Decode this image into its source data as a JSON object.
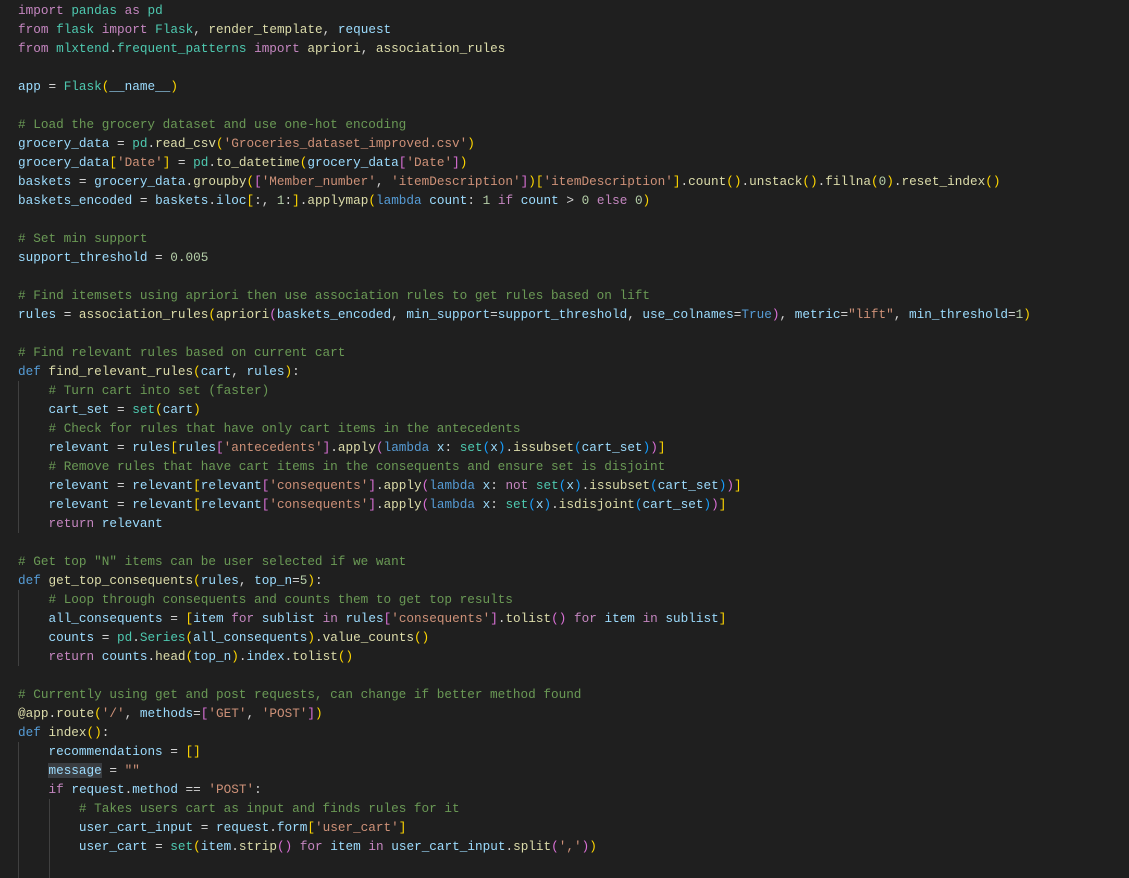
{
  "editor": {
    "language": "python",
    "theme_colors": {
      "background": "#1f1f1f",
      "keyword_control": "#c586c0",
      "keyword_storage": "#569cd6",
      "function": "#dcdcaa",
      "variable": "#9cdcfe",
      "type": "#4ec9b0",
      "string": "#ce9178",
      "number": "#b5cea8",
      "comment": "#6a9955",
      "bracket_level_1": "#ffd700",
      "bracket_level_2": "#da70d6",
      "bracket_level_3": "#179fff"
    },
    "highlighted_word": "message",
    "lines": [
      "import pandas as pd",
      "from flask import Flask, render_template, request",
      "from mlxtend.frequent_patterns import apriori, association_rules",
      "",
      "app = Flask(__name__)",
      "",
      "# Load the grocery dataset and use one-hot encoding",
      "grocery_data = pd.read_csv('Groceries_dataset_improved.csv')",
      "grocery_data['Date'] = pd.to_datetime(grocery_data['Date'])",
      "baskets = grocery_data.groupby(['Member_number', 'itemDescription'])['itemDescription'].count().unstack().fillna(0).reset_index()",
      "baskets_encoded = baskets.iloc[:, 1:].applymap(lambda count: 1 if count > 0 else 0)",
      "",
      "# Set min support",
      "support_threshold = 0.005",
      "",
      "# Find itemsets using apriori then use association rules to get rules based on lift",
      "rules = association_rules(apriori(baskets_encoded, min_support=support_threshold, use_colnames=True), metric=\"lift\", min_threshold=1)",
      "",
      "# Find relevant rules based on current cart",
      "def find_relevant_rules(cart, rules):",
      "    # Turn cart into set (faster)",
      "    cart_set = set(cart)",
      "    # Check for rules that have only cart items in the antecedents",
      "    relevant = rules[rules['antecedents'].apply(lambda x: set(x).issubset(cart_set))]",
      "    # Remove rules that have cart items in the consequents and ensure set is disjoint",
      "    relevant = relevant[relevant['consequents'].apply(lambda x: not set(x).issubset(cart_set))]",
      "    relevant = relevant[relevant['consequents'].apply(lambda x: set(x).isdisjoint(cart_set))]",
      "    return relevant",
      "",
      "# Get top \"N\" items can be user selected if we want",
      "def get_top_consequents(rules, top_n=5):",
      "    # Loop through consequents and counts them to get top results",
      "    all_consequents = [item for sublist in rules['consequents'].tolist() for item in sublist]",
      "    counts = pd.Series(all_consequents).value_counts()",
      "    return counts.head(top_n).index.tolist()",
      "",
      "# Currently using get and post requests, can change if better method found",
      "@app.route('/', methods=['GET', 'POST'])",
      "def index():",
      "    recommendations = []",
      "    message = \"\"",
      "    if request.method == 'POST':",
      "        # Takes users cart as input and finds rules for it",
      "        user_cart_input = request.form['user_cart']",
      "        user_cart = set(item.strip() for item in user_cart_input.split(','))",
      ""
    ]
  }
}
